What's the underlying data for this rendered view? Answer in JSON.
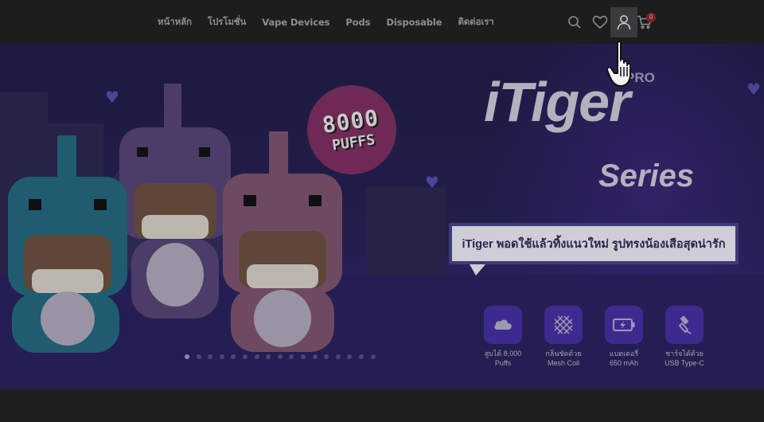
{
  "nav": {
    "items": [
      "หน้าหลัก",
      "โปรโมชั่น",
      "Vape Devices",
      "Pods",
      "Disposable",
      "ติดต่อเรา"
    ]
  },
  "header_icons": [
    "search-icon",
    "heart-icon",
    "user-icon",
    "cart-icon"
  ],
  "cart": {
    "count": "0"
  },
  "banner": {
    "puffs_number": "8000",
    "puffs_label": "PUFFS",
    "brand_badge": "PRO",
    "title_line1": "iTiger",
    "title_line2": "Series",
    "tagline": "iTiger พอดใช้แล้วทิ้งแนวใหม่ รูปทรงน้องเสือสุดน่ารัก",
    "features": [
      {
        "icon": "cloud-icon",
        "line1": "สูบได้ 8,000",
        "line2": "Puffs"
      },
      {
        "icon": "mesh-coil-icon",
        "line1": "กลิ่นชัดด้วย",
        "line2": "Mesh Coil"
      },
      {
        "icon": "battery-icon",
        "line1": "แบตเตอรี่",
        "line2": "650 mAh"
      },
      {
        "icon": "usb-c-icon",
        "line1": "ชาร์จได้ด้วย",
        "line2": "USB Type-C"
      }
    ]
  },
  "carousel": {
    "total": 17,
    "active": 1
  },
  "colors": {
    "header_bg": "#1d1d1e",
    "banner_bg": "#221d4a",
    "feature_box": "#3e2a8f",
    "puffs_circle": "#6e2a55",
    "cart_badge": "#7a2222"
  }
}
